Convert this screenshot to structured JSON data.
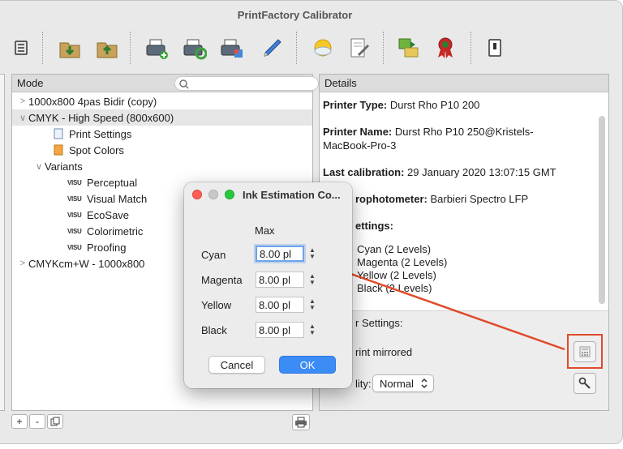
{
  "app": {
    "title": "PrintFactory Calibrator"
  },
  "toolbar": {
    "items": [
      "list-icon",
      "import-icon",
      "export-icon",
      "printer-add-icon",
      "printer-sync-icon",
      "printer-settings-icon",
      "pencil-icon",
      "sun-icon",
      "edit-document-icon",
      "spot-color-icon",
      "ribbon-award-icon",
      "switch-icon"
    ]
  },
  "mode": {
    "header": "Mode",
    "search_placeholder": "",
    "tree": [
      {
        "label": "1000x800 4pas Bidir (copy)",
        "chevron": ">"
      },
      {
        "label": "CMYK - High Speed (800x600)",
        "chevron": "∨"
      },
      {
        "label": "Print Settings"
      },
      {
        "label": "Spot Colors"
      },
      {
        "label": "Variants",
        "chevron": "∨"
      },
      {
        "label": "Perceptual",
        "badge": "VISU"
      },
      {
        "label": "Visual Match",
        "badge": "VISU"
      },
      {
        "label": "EcoSave",
        "badge": "VISU"
      },
      {
        "label": "Colorimetric",
        "badge": "VISU"
      },
      {
        "label": "Proofing",
        "badge": "VISU"
      },
      {
        "label": "CMYKcm+W - 1000x800",
        "chevron": ">"
      }
    ],
    "bottom_buttons": [
      "+",
      "-"
    ]
  },
  "details": {
    "header": "Details",
    "printer_type_label": "Printer Type:",
    "printer_type_value": "Durst Rho P10 200",
    "printer_name_label": "Printer Name:",
    "printer_name_value_1": "Durst Rho P10 250@Kristels-",
    "printer_name_value_2": "MacBook-Pro-3",
    "last_calibration_label": "Last calibration:",
    "last_calibration_value": "29 January 2020 13:07:15 GMT",
    "spectro_label": "rophotometer:",
    "spectro_value": "Barbieri Spectro LFP",
    "settings_label": "ettings:",
    "settings_items": [
      "Cyan (2 Levels)",
      "Magenta (2 Levels)",
      "Yellow (2 Levels)",
      "Black (2 Levels)"
    ],
    "other_settings_label": "r Settings:",
    "print_mirrored_label": "rint mirrored",
    "quality_label": "lity:",
    "quality_value": "Normal"
  },
  "dialog": {
    "title": "Ink Estimation Co...",
    "column_header": "Max",
    "rows": [
      {
        "label": "Cyan",
        "value": "8.00 pl"
      },
      {
        "label": "Magenta",
        "value": "8.00 pl"
      },
      {
        "label": "Yellow",
        "value": "8.00 pl"
      },
      {
        "label": "Black",
        "value": "8.00 pl"
      }
    ],
    "cancel_label": "Cancel",
    "ok_label": "OK"
  },
  "colors": {
    "accent": "#3b8cf6",
    "annotation": "#e04a2a",
    "traffic_close": "#ff5f57",
    "traffic_min": "#c8c8c8",
    "traffic_zoom": "#28c840"
  }
}
